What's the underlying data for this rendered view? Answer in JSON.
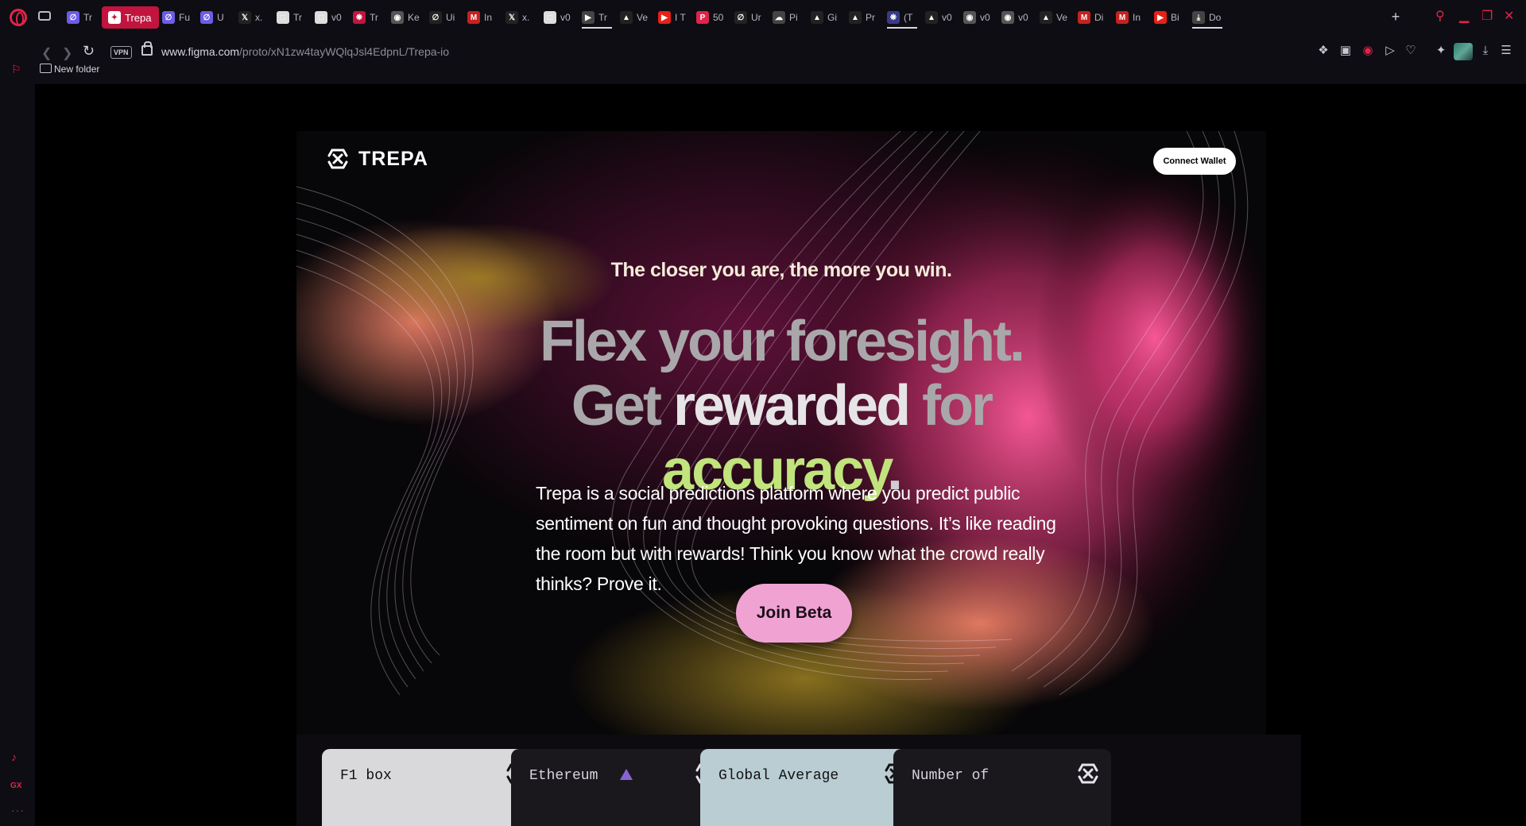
{
  "browser": {
    "tabs": [
      {
        "label": "Tr",
        "favicon": "framer-icon",
        "color": "#6c5ce7"
      },
      {
        "label": "Trepa",
        "favicon": "figma-icon",
        "color": "#c1153f",
        "active": true
      },
      {
        "label": "Fu",
        "favicon": "framer-icon",
        "color": "#6c5ce7"
      },
      {
        "label": "U",
        "favicon": "framer-icon",
        "color": "#6c5ce7"
      },
      {
        "label": "x.",
        "favicon": "x-icon",
        "color": "#222"
      },
      {
        "label": "Tr",
        "favicon": "doc-icon",
        "color": "#ddd"
      },
      {
        "label": "v0",
        "favicon": "doc-icon",
        "color": "#ddd"
      },
      {
        "label": "Tr",
        "favicon": "trepa-icon",
        "color": "#c1153f"
      },
      {
        "label": "Ke",
        "favicon": "globe-icon",
        "color": "#555"
      },
      {
        "label": "Ui",
        "favicon": "framer-icon",
        "color": "#222"
      },
      {
        "label": "In",
        "favicon": "gmail-icon",
        "color": "#c5221f"
      },
      {
        "label": "x.",
        "favicon": "x-icon",
        "color": "#222"
      },
      {
        "label": "v0",
        "favicon": "doc-icon",
        "color": "#ddd"
      },
      {
        "label": "Tr",
        "favicon": "vo-icon",
        "color": "#444",
        "underline": true
      },
      {
        "label": "Ve",
        "favicon": "vercel-icon",
        "color": "#222"
      },
      {
        "label": "I T",
        "favicon": "youtube-icon",
        "color": "#e62117"
      },
      {
        "label": "50",
        "favicon": "pinterest-icon",
        "color": "#e0244a"
      },
      {
        "label": "Ur",
        "favicon": "framer-icon",
        "color": "#222"
      },
      {
        "label": "Pi",
        "favicon": "cloud-icon",
        "color": "#444"
      },
      {
        "label": "Gi",
        "favicon": "vercel-icon",
        "color": "#222"
      },
      {
        "label": "Pr",
        "favicon": "vercel-icon",
        "color": "#222"
      },
      {
        "label": "(T",
        "favicon": "trepa-icon",
        "color": "#3a3a8a",
        "underline": true
      },
      {
        "label": "v0",
        "favicon": "vercel-icon",
        "color": "#222"
      },
      {
        "label": "v0",
        "favicon": "globe-icon",
        "color": "#555"
      },
      {
        "label": "v0",
        "favicon": "globe-icon",
        "color": "#555"
      },
      {
        "label": "Ve",
        "favicon": "vercel-icon",
        "color": "#222"
      },
      {
        "label": "Di",
        "favicon": "gmail-icon",
        "color": "#c5221f"
      },
      {
        "label": "In",
        "favicon": "gmail-icon",
        "color": "#c5221f"
      },
      {
        "label": "Bi",
        "favicon": "youtube-icon",
        "color": "#e62117"
      },
      {
        "label": "Do",
        "favicon": "download-icon",
        "color": "#444",
        "underline": true
      }
    ],
    "vpn_label": "VPN",
    "url_domain": "www.figma.com",
    "url_path": "/proto/xN1zw4tayWQlqJsl4EdpnL/Trepa-io",
    "bookmark_folder": "New folder",
    "sidebar_gx": "GX"
  },
  "page": {
    "brand": "TREPA",
    "connect_wallet": "Connect Wallet",
    "kicker": "The closer you are, the more you win.",
    "headline_line1": "Flex your foresight.",
    "headline_line2_a": "Get ",
    "headline_line2_b": "rewarded",
    "headline_line2_c": " for",
    "headline_line3": "accuracy",
    "headline_line3_dot": ".",
    "description": "Trepa is a social predictions platform where you predict public sentiment on fun and thought provoking questions. It’s like reading the room but with rewards! Think you know what the crowd really thinks? Prove it.",
    "cta": "Join Beta",
    "cards": [
      {
        "title": "F1 box",
        "bg": "#d9d8da",
        "theme": "light"
      },
      {
        "title": "Ethereum",
        "bg": "#1a181d",
        "theme": "dark",
        "icon": "ethereum-icon"
      },
      {
        "title": "Global Average",
        "bg": "#b9cdd3",
        "theme": "light"
      },
      {
        "title": "Number of",
        "bg": "#1a181d",
        "theme": "dark"
      }
    ]
  },
  "colors": {
    "accent": "#e0244a",
    "cta_pink": "#f0a3d3",
    "headline_green": "#c1e47c"
  }
}
